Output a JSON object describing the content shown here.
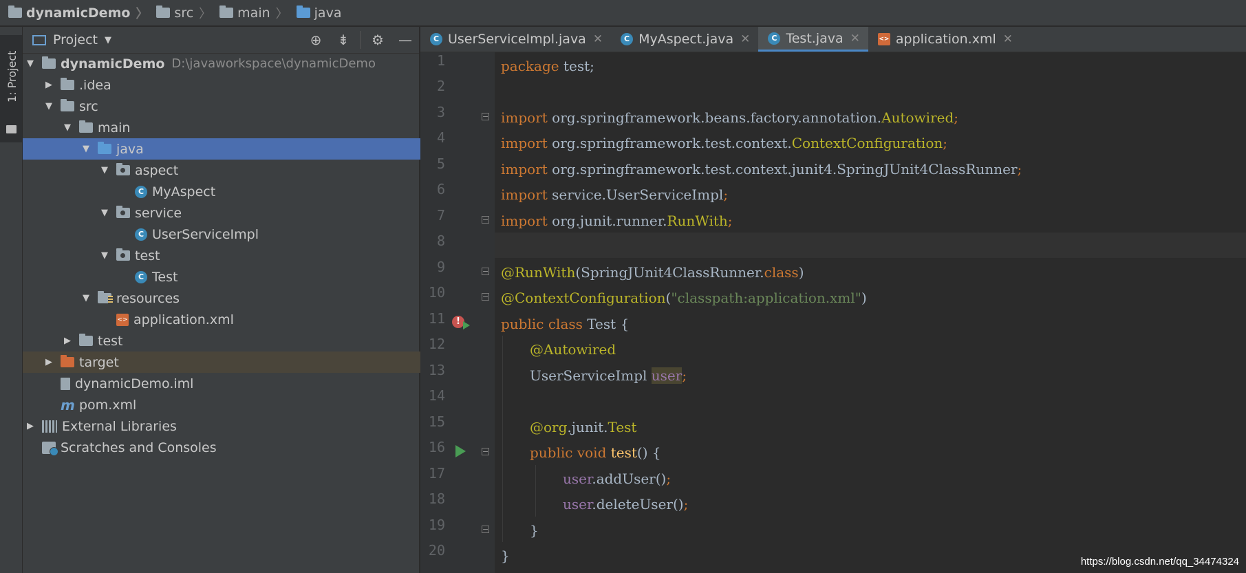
{
  "breadcrumb": [
    "dynamicDemo",
    "src",
    "main",
    "java"
  ],
  "tool_strip": {
    "project_tab": "1: Project"
  },
  "project_panel": {
    "title": "Project",
    "tree": [
      {
        "name": "dynamicDemo",
        "path": "D:\\javaworkspace\\dynamicDemo"
      },
      {
        "name": ".idea"
      },
      {
        "name": "src"
      },
      {
        "name": "main"
      },
      {
        "name": "java"
      },
      {
        "name": "aspect"
      },
      {
        "name": "MyAspect"
      },
      {
        "name": "service"
      },
      {
        "name": "UserServiceImpl"
      },
      {
        "name": "test"
      },
      {
        "name": "Test"
      },
      {
        "name": "resources"
      },
      {
        "name": "application.xml"
      },
      {
        "name": "test"
      },
      {
        "name": "target"
      },
      {
        "name": "dynamicDemo.iml"
      },
      {
        "name": "pom.xml"
      },
      {
        "name": "External Libraries"
      },
      {
        "name": "Scratches and Consoles"
      }
    ]
  },
  "tabs": [
    {
      "label": "UserServiceImpl.java"
    },
    {
      "label": "MyAspect.java"
    },
    {
      "label": "Test.java"
    },
    {
      "label": "application.xml"
    }
  ],
  "editor": {
    "line_numbers": [
      "1",
      "2",
      "3",
      "4",
      "5",
      "6",
      "7",
      "8",
      "9",
      "10",
      "11",
      "12",
      "13",
      "14",
      "15",
      "16",
      "17",
      "18",
      "19",
      "20"
    ],
    "code": {
      "l1_kw": "package",
      "l1_rest": " test;",
      "l3_kw": "import",
      "l3_pkg": " org.springframework.beans.factory.annotation.",
      "l3_cls": "Autowired",
      "l3_semi": ";",
      "l4_kw": "import",
      "l4_pkg": " org.springframework.test.context.",
      "l4_cls": "ContextConfiguration",
      "l4_semi": ";",
      "l5_kw": "import",
      "l5_pkg": " org.springframework.test.context.junit4.SpringJUnit4ClassRunner",
      "l5_semi": ";",
      "l6_kw": "import",
      "l6_pkg": " service.UserServiceImpl",
      "l6_semi": ";",
      "l7_kw": "import",
      "l7_pkg": " org.junit.runner.",
      "l7_cls": "RunWith",
      "l7_semi": ";",
      "l9_ann": "@RunWith",
      "l9_a": "(SpringJUnit4ClassRunner.",
      "l9_kw": "class",
      "l9_b": ")",
      "l10_ann": "@ContextConfiguration",
      "l10_a": "(",
      "l10_str": "\"classpath:application.xml\"",
      "l10_b": ")",
      "l11_kw1": "public",
      "l11_kw2": " class",
      "l11_rest": " Test {",
      "l12_ann": "@Autowired",
      "l13_type": "UserServiceImpl ",
      "l13_field": "user",
      "l13_semi": ";",
      "l15_ann1": "@org",
      "l15_mid": ".junit.",
      "l15_ann2": "Test",
      "l16_kw1": "public",
      "l16_kw2": " void",
      "l16_fn": " test",
      "l16_rest": "() {",
      "l17_field": "user",
      "l17_rest": ".addUser()",
      "l17_semi": ";",
      "l18_field": "user",
      "l18_rest": ".deleteUser()",
      "l18_semi": ";",
      "l19": "}",
      "l20": "}"
    }
  },
  "watermark": "https://blog.csdn.net/qq_34474324",
  "colors": {
    "selection": "#4b6eaf",
    "keyword": "#cc7832",
    "annotation": "#bbb529",
    "string": "#6a8759",
    "field": "#9876aa"
  }
}
